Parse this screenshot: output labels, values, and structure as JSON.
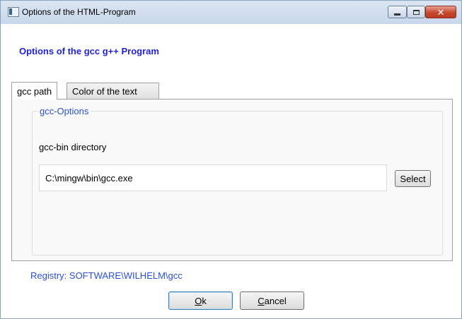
{
  "window": {
    "title": "Options of the HTML-Program",
    "controls": {
      "minimize_icon": "minimize-icon",
      "maximize_icon": "maximize-icon",
      "close_glyph": "✕"
    }
  },
  "heading": "Options of the gcc g++ Program",
  "tabs": [
    {
      "label": "gcc path",
      "selected": true
    },
    {
      "label": "Color of the text",
      "selected": false
    }
  ],
  "group": {
    "title": "gcc-Options",
    "dir_label": "gcc-bin directory",
    "path_value": "C:\\mingw\\bin\\gcc.exe",
    "select_label": "Select"
  },
  "registry": "Registry: SOFTWARE\\WILHELM\\gcc",
  "buttons": {
    "ok": {
      "mnemonic": "O",
      "rest": "k"
    },
    "cancel": {
      "mnemonic": "C",
      "rest": "ancel"
    }
  },
  "colors": {
    "accent_blue": "#2a4fd6",
    "heading_blue": "#1f1fd6",
    "close_red": "#c7482f"
  }
}
